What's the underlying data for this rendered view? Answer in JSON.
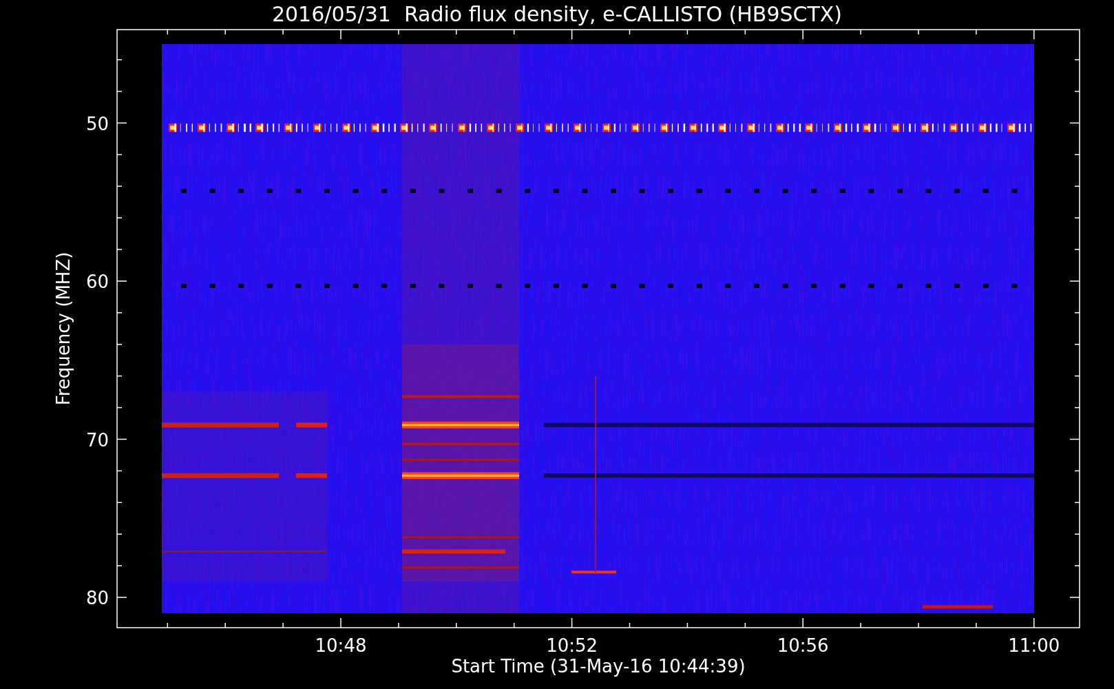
{
  "title": "2016/05/31  Radio flux density, e-CALLISTO (HB9SCTX)",
  "xaxis": {
    "label": "Start Time (31-May-16 10:44:39)",
    "ticks": [
      "10:48",
      "10:52",
      "10:56",
      "11:00"
    ]
  },
  "yaxis": {
    "label": "Frequency (MHZ)",
    "ticks": [
      "50",
      "60",
      "70",
      "80"
    ]
  }
}
